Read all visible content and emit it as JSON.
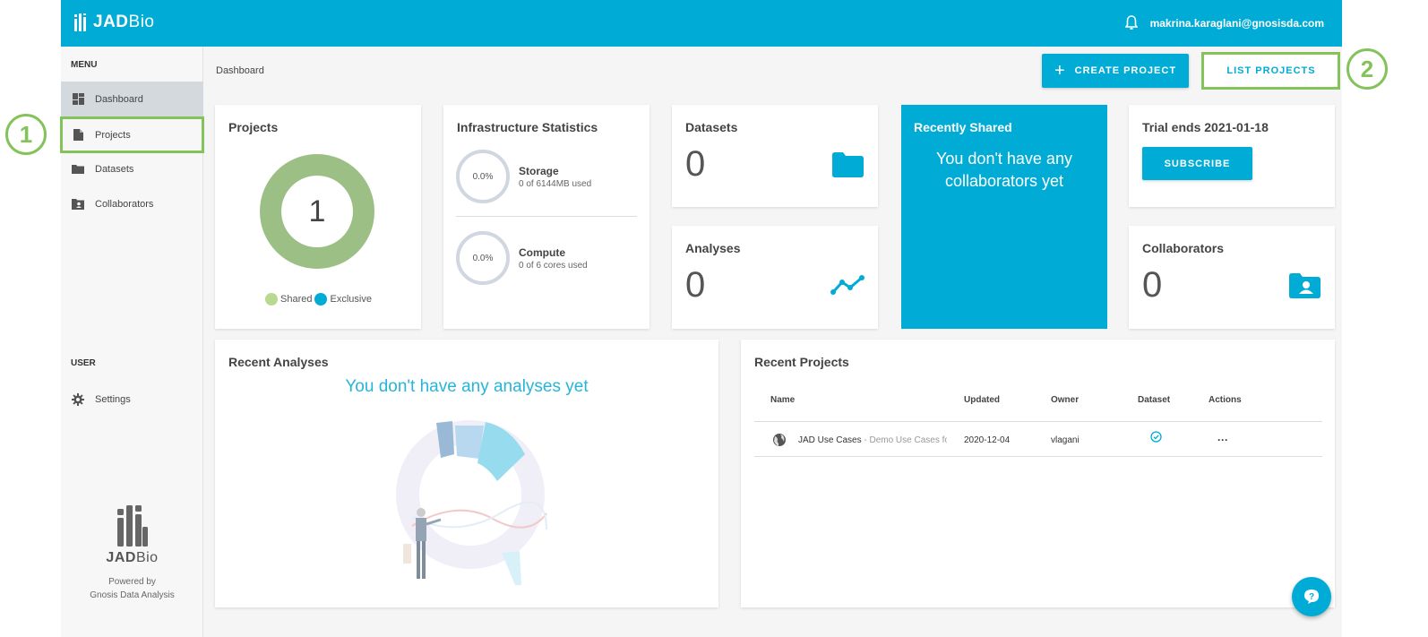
{
  "app": {
    "logo_text_bold": "JAD",
    "logo_text_thin": "Bio",
    "user_email": "makrina.karaglani@gnosisda.com"
  },
  "sidebar": {
    "menu_heading": "MENU",
    "items": [
      {
        "label": "Dashboard",
        "icon": "dashboard-icon"
      },
      {
        "label": "Projects",
        "icon": "document-icon"
      },
      {
        "label": "Datasets",
        "icon": "folder-icon"
      },
      {
        "label": "Collaborators",
        "icon": "contacts-folder-icon"
      }
    ],
    "user_heading": "USER",
    "settings_label": "Settings",
    "brand_name_bold": "JAD",
    "brand_name_thin": "Bio",
    "powered_by": "Powered by",
    "company": "Gnosis Data Analysis"
  },
  "header": {
    "breadcrumb": "Dashboard",
    "create_project": "CREATE PROJECT",
    "list_projects": "LIST PROJECTS"
  },
  "projects_card": {
    "title": "Projects",
    "count": "1",
    "legend_shared": "Shared",
    "legend_exclusive": "Exclusive"
  },
  "infra_card": {
    "title": "Infrastructure Statistics",
    "storage": {
      "percent": "0.0%",
      "label": "Storage",
      "detail": "0 of 6144MB used"
    },
    "compute": {
      "percent": "0.0%",
      "label": "Compute",
      "detail": "0 of 6 cores used"
    }
  },
  "datasets_card": {
    "title": "Datasets",
    "count": "0"
  },
  "analyses_card": {
    "title": "Analyses",
    "count": "0"
  },
  "recently_shared": {
    "title": "Recently Shared",
    "message": "You don't have any collaborators yet"
  },
  "trial_card": {
    "title": "Trial ends 2021-01-18",
    "subscribe": "SUBSCRIBE"
  },
  "collaborators_card": {
    "title": "Collaborators",
    "count": "0"
  },
  "recent_analyses": {
    "title": "Recent Analyses",
    "empty_message": "You don't have any analyses yet"
  },
  "recent_projects": {
    "title": "Recent Projects",
    "columns": [
      "Name",
      "Updated",
      "Owner",
      "Dataset",
      "Actions"
    ],
    "rows": [
      {
        "name": "JAD Use Cases",
        "description": "- Demo Use Cases for",
        "updated": "2020-12-04",
        "owner": "vlagani",
        "actions": "···"
      }
    ]
  },
  "annotations": {
    "callout_1": "1",
    "callout_2": "2"
  },
  "colors": {
    "accent": "#00acd6",
    "donut_shared": "#9cbf85",
    "callout_green": "#84c35a"
  }
}
